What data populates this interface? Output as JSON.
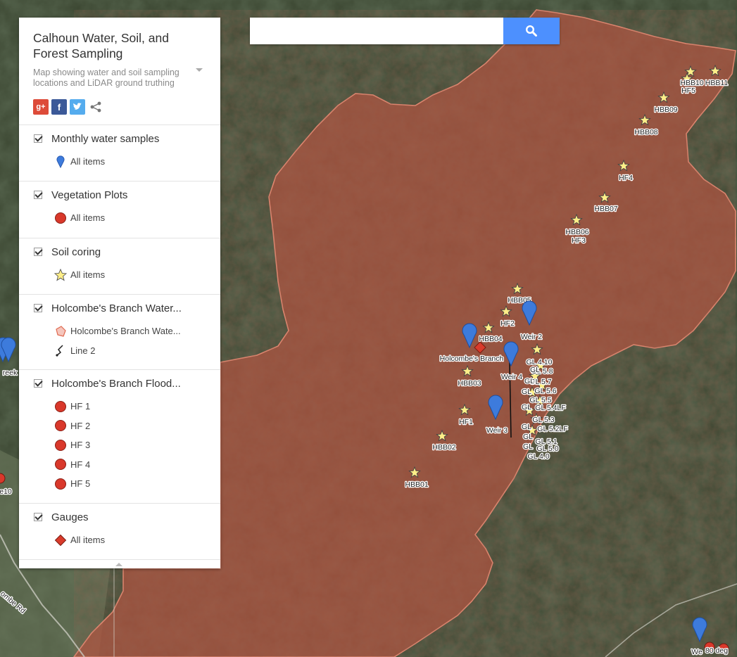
{
  "panel": {
    "title": "Calhoun Water, Soil, and Forest Sampling",
    "description": "Map showing water and soil sampling locations and LiDAR ground truthing",
    "layers": [
      {
        "name": "Monthly water samples",
        "items": [
          {
            "label": "All items",
            "icon": "blue-pin-icon"
          }
        ]
      },
      {
        "name": "Vegetation Plots",
        "items": [
          {
            "label": "All items",
            "icon": "red-dot-icon"
          }
        ]
      },
      {
        "name": "Soil coring",
        "items": [
          {
            "label": "All items",
            "icon": "yellow-star-icon"
          }
        ]
      },
      {
        "name": "Holcombe's Branch Water...",
        "items": [
          {
            "label": "Holcombe's Branch Wate...",
            "icon": "polygon-icon"
          },
          {
            "label": "Line 2",
            "icon": "line-icon"
          }
        ]
      },
      {
        "name": "Holcombe's Branch Flood...",
        "items": [
          {
            "label": "HF 1",
            "icon": "red-dot-icon"
          },
          {
            "label": "HF 2",
            "icon": "red-dot-icon"
          },
          {
            "label": "HF 3",
            "icon": "red-dot-icon"
          },
          {
            "label": "HF 4",
            "icon": "red-dot-icon"
          },
          {
            "label": "HF 5",
            "icon": "red-dot-icon"
          }
        ]
      },
      {
        "name": "Gauges",
        "items": [
          {
            "label": "All items",
            "icon": "red-diamond-icon"
          }
        ]
      }
    ]
  },
  "search": {
    "placeholder": ""
  },
  "map": {
    "road_label": "ombe Rd",
    "stars": [
      {
        "label": "HBB10"
      },
      {
        "label": "HBB11"
      },
      {
        "label": "HF5"
      },
      {
        "label": "HBB09"
      },
      {
        "label": "HBB08"
      },
      {
        "label": "HF4"
      },
      {
        "label": "HBB07"
      },
      {
        "label": "HBB06"
      },
      {
        "label": "HF3"
      },
      {
        "label": "HBB05"
      },
      {
        "label": "HF2"
      },
      {
        "label": "HBB04"
      },
      {
        "label": "HBB03"
      },
      {
        "label": "HF1"
      },
      {
        "label": "HBB02"
      },
      {
        "label": "HBB01"
      }
    ],
    "pins": [
      {
        "label": "Weir 2"
      },
      {
        "label": "Holcombe's Branch"
      },
      {
        "label": "Weir 4"
      },
      {
        "label": "Weir 3"
      },
      {
        "label": "We"
      }
    ],
    "gl_labels": [
      "GL 4.10",
      "GL 5.8",
      "GL 5.7",
      "GL 5.6",
      "GL 5.5",
      "GL 5.4LF",
      "GL 5.3",
      "GL 5.2LF",
      "GL 5.1",
      "GL 5.0",
      "GL 4.0"
    ],
    "edge_labels": [
      "reek",
      "e10",
      "80 deg"
    ],
    "colors": {
      "watershed": "#b6523f",
      "pin": "#3d7bdc",
      "star": "#ffee88",
      "gauge": "#d93b2b",
      "dot": "#d9382b"
    }
  }
}
